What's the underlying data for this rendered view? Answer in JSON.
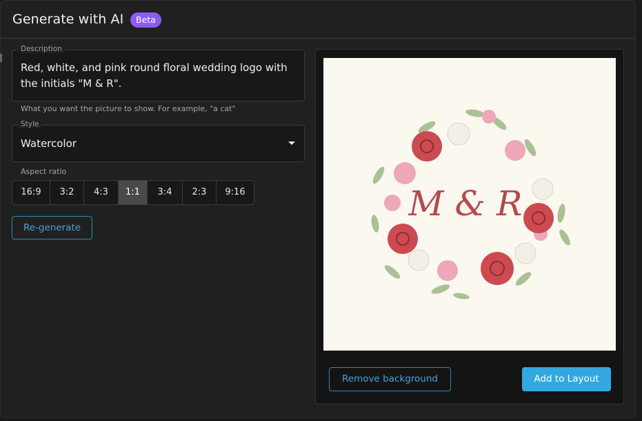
{
  "dialog": {
    "title": "Generate with AI",
    "badge": "Beta"
  },
  "description": {
    "label": "Description",
    "value": "Red, white, and pink round floral wedding logo with the initials \"M & R\".",
    "helper": "What you want the picture to show. For example, \"a cat\""
  },
  "style": {
    "label": "Style",
    "value": "Watercolor",
    "icon": "chevron-down-icon"
  },
  "aspect": {
    "label": "Aspect ratio",
    "options": [
      "16:9",
      "3:2",
      "4:3",
      "1:1",
      "3:4",
      "2:3",
      "9:16"
    ],
    "selected": "1:1"
  },
  "actions": {
    "regenerate": "Re-generate",
    "remove_background": "Remove background",
    "add_to_layout": "Add to Layout"
  },
  "preview": {
    "monogram": "M & R",
    "colors": {
      "red": "#c8454a",
      "pink": "#e79aae",
      "white": "#f4f2ea",
      "leaf": "#8fb07b",
      "monogram": "#b34a4e"
    }
  },
  "colors": {
    "accent": "#33a8e0",
    "badge": "#8b5cf6"
  }
}
